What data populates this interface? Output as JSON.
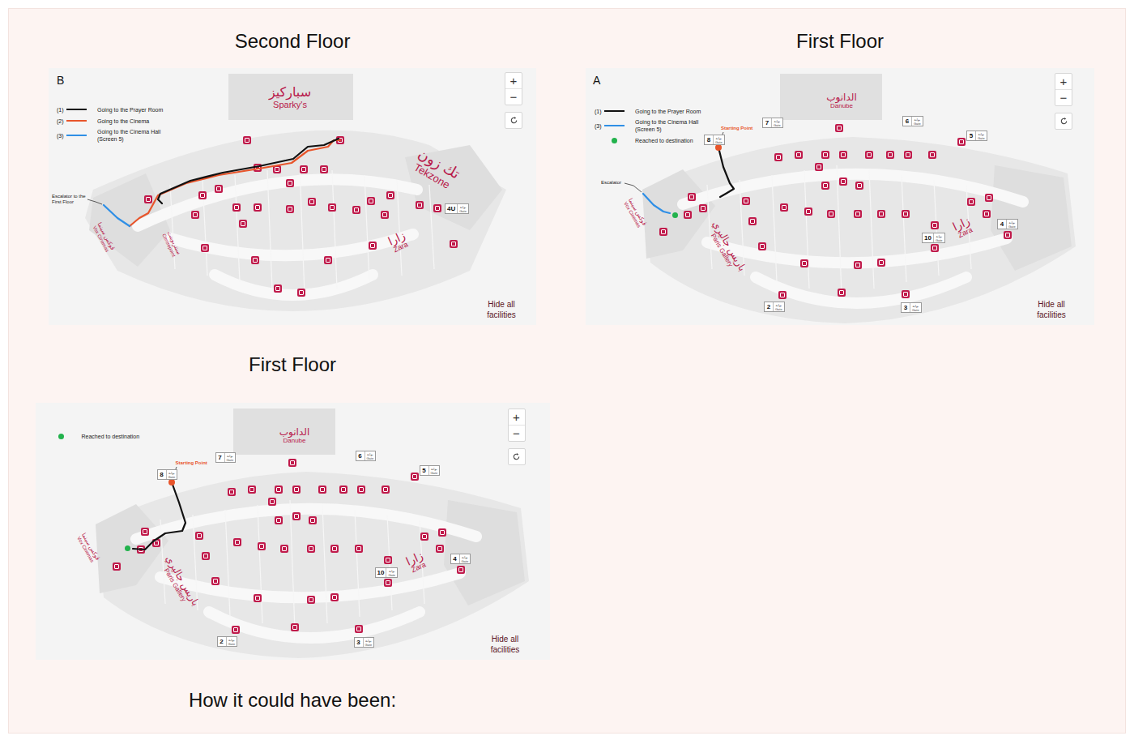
{
  "maps": [
    {
      "title": "Second Floor",
      "letter": "B",
      "legend": [
        {
          "kind": "line",
          "marker": "(1)",
          "label": "Going to the Prayer Room",
          "color": "#111111"
        },
        {
          "kind": "line",
          "marker": "(2)",
          "label": "Going to the Cinema",
          "color": "#e8552b"
        },
        {
          "kind": "line",
          "marker": "(3)",
          "label": "Going to the Cinema Hall (Screen 5)",
          "color": "#2f8fe6"
        }
      ],
      "controls": {
        "zoom_in": "+",
        "zoom_out": "−"
      },
      "hide_facilities": "Hide all facilities",
      "stores": [
        {
          "arabic": "سباركيز",
          "english": "Sparky's"
        },
        {
          "arabic": "تك زون",
          "english": "Tekzone"
        },
        {
          "arabic": "زارا",
          "english": "Zara"
        },
        {
          "arabic": "سنتربوينت",
          "english": "Centrepoint"
        },
        {
          "arabic": "ڤوكس سينما",
          "english": "Vox Cinemas"
        }
      ],
      "gates": [
        {
          "number": "4U",
          "arabic": "بوابة",
          "english": "Gate"
        }
      ],
      "callouts": [
        {
          "kind": "label",
          "text": "Escalator to the First Floor"
        }
      ],
      "routes": [
        {
          "color": "#e8552b"
        },
        {
          "color": "#111111"
        },
        {
          "color": "#2f8fe6"
        }
      ]
    },
    {
      "title": "First Floor",
      "letter": "A",
      "legend": [
        {
          "kind": "line",
          "marker": "(1)",
          "label": "Going to the Prayer Room",
          "color": "#111111"
        },
        {
          "kind": "line",
          "marker": "(3)",
          "label": "Going to the Cinema Hall (Screen 5)",
          "color": "#2f8fe6"
        },
        {
          "kind": "dot",
          "label": "Reached to destination",
          "color": "#22b24c"
        }
      ],
      "controls": {
        "zoom_in": "+",
        "zoom_out": "−"
      },
      "hide_facilities": "Hide all facilities",
      "stores": [
        {
          "arabic": "الدانوب",
          "english": "Danube"
        },
        {
          "arabic": "زارا",
          "english": "Zara"
        },
        {
          "arabic": "باريس جاليري",
          "english": "Paris Gallery"
        },
        {
          "arabic": "ڤوكس سينما",
          "english": "Vox Cinemas"
        }
      ],
      "gates": [
        {
          "number": "7",
          "arabic": "بوابة",
          "english": "Gate"
        },
        {
          "number": "6",
          "arabic": "بوابة",
          "english": "Gate"
        },
        {
          "number": "8",
          "arabic": "بوابة",
          "english": "Gate"
        },
        {
          "number": "5",
          "arabic": "بوابة",
          "english": "Gate"
        },
        {
          "number": "4",
          "arabic": "بوابة",
          "english": "Gate"
        },
        {
          "number": "10",
          "arabic": "بوابة",
          "english": "Gate"
        },
        {
          "number": "2",
          "arabic": "بوابة",
          "english": "Gate"
        },
        {
          "number": "3",
          "arabic": "بوابة",
          "english": "Gate"
        }
      ],
      "callouts": [
        {
          "kind": "start",
          "text": "Starting Point"
        },
        {
          "kind": "label",
          "text": "Escalator"
        }
      ],
      "routes": [
        {
          "color": "#111111"
        },
        {
          "color": "#2f8fe6"
        }
      ]
    },
    {
      "title": "First Floor",
      "legend": [
        {
          "kind": "dot",
          "label": "Reached to destination",
          "color": "#22b24c"
        }
      ],
      "controls": {
        "zoom_in": "+",
        "zoom_out": "−"
      },
      "hide_facilities": "Hide all facilities",
      "stores": [
        {
          "arabic": "الدانوب",
          "english": "Danube"
        },
        {
          "arabic": "زارا",
          "english": "Zara"
        },
        {
          "arabic": "باريس جاليري",
          "english": "Paris Gallery"
        },
        {
          "arabic": "ڤوكس سينما",
          "english": "Vox Cinemas"
        }
      ],
      "gates": [
        {
          "number": "7",
          "arabic": "بوابة",
          "english": "Gate"
        },
        {
          "number": "6",
          "arabic": "بوابة",
          "english": "Gate"
        },
        {
          "number": "8",
          "arabic": "بوابة",
          "english": "Gate"
        },
        {
          "number": "5",
          "arabic": "بوابة",
          "english": "Gate"
        },
        {
          "number": "4",
          "arabic": "بوابة",
          "english": "Gate"
        },
        {
          "number": "10",
          "arabic": "بوابة",
          "english": "Gate"
        },
        {
          "number": "2",
          "arabic": "بوابة",
          "english": "Gate"
        },
        {
          "number": "3",
          "arabic": "بوابة",
          "english": "Gate"
        }
      ],
      "callouts": [
        {
          "kind": "start",
          "text": "Starting Point"
        }
      ],
      "routes": [
        {
          "color": "#111111"
        }
      ]
    }
  ],
  "caption": "How it could have been:"
}
